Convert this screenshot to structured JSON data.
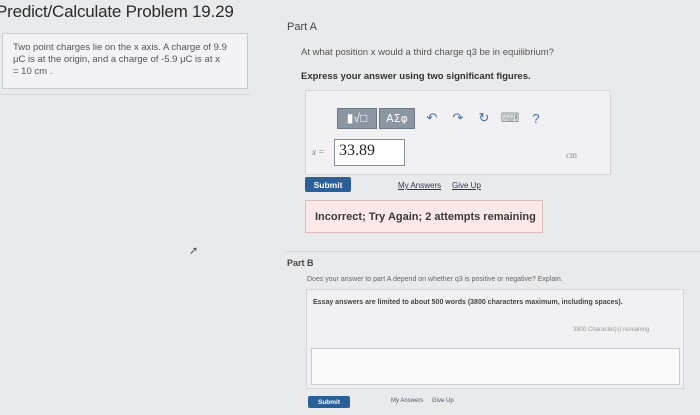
{
  "header": {
    "title": "Predict/Calculate Problem 19.29"
  },
  "problem": {
    "line1": "Two point charges lie on the x axis. A charge of 9.9",
    "line2": "μC is at the origin, and a charge of -5.9 μC is at x",
    "line3": "= 10 cm ."
  },
  "part_a": {
    "title": "Part A",
    "question": "At what position x would a third charge q3 be in equilibrium?",
    "instruction": "Express your answer using two significant figures.",
    "toolbar": {
      "template_label": "▮√□",
      "greek_label": "ΑΣφ",
      "undo_glyph": "↶",
      "redo_glyph": "↷",
      "reset_glyph": "↻",
      "keyboard_glyph": "⌨",
      "help_glyph": "?"
    },
    "variable_label": "x =",
    "answer_value": "33.89",
    "unit": "cm",
    "submit_label": "Submit",
    "my_answers_label": "My Answers",
    "give_up_label": "Give Up",
    "feedback": "Incorrect; Try Again; 2 attempts remaining"
  },
  "part_b": {
    "title": "Part B",
    "question": "Does your answer to part A depend on whether q3 is positive or negative? Explain.",
    "essay_note": "Essay answers are limited to about 500 words (3800 characters maximum, including spaces).",
    "char_count": "3800 Character(s) remaining",
    "submit_label": "Submit",
    "my_answers_label": "My Answers",
    "give_up_label": "Give Up"
  },
  "colors": {
    "submit_blue": "#2a5f97",
    "feedback_bg": "#fce8e8",
    "toolbar_btn": "#8b96a3"
  }
}
